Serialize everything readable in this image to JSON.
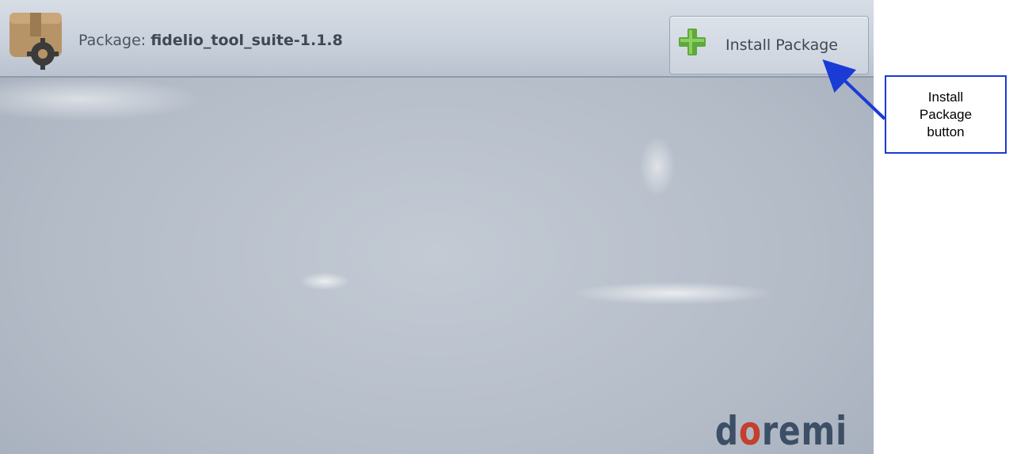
{
  "header": {
    "package_label": "Package:",
    "package_name": "fidelio_tool_suite-1.1.8",
    "package_icon": "package-gear-icon"
  },
  "install_button": {
    "label": "Install Package",
    "icon": "plus-icon"
  },
  "brand": {
    "logo_part1": "d",
    "logo_part2": "o",
    "logo_part3": "remi",
    "colors": {
      "dark": "#3d4f66",
      "accent": "#c3402c"
    }
  },
  "annotation": {
    "text": "Install\nPackage\nbutton",
    "border_color": "#1a3bd6"
  }
}
